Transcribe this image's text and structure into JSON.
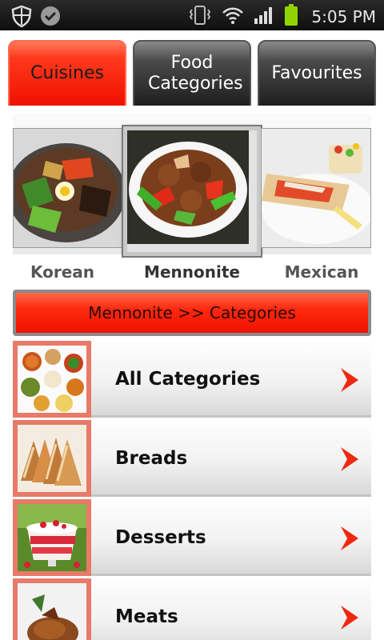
{
  "status_bar": {
    "time": "5:05 PM",
    "icons": [
      "shield-icon",
      "check-icon",
      "vibrate-icon",
      "wifi-icon",
      "signal-icon",
      "battery-icon"
    ]
  },
  "tabs": [
    {
      "label": "Cuisines",
      "active": true
    },
    {
      "label": "Food Categories",
      "active": false
    },
    {
      "label": "Favourites",
      "active": false
    }
  ],
  "carousel": {
    "items": [
      {
        "label": "Korean",
        "image": "bibimbap-photo"
      },
      {
        "label": "Mennonite",
        "image": "stir-fry-photo",
        "selected": true
      },
      {
        "label": "Mexican",
        "image": "burrito-photo"
      }
    ]
  },
  "breadcrumb": {
    "text": "Mennonite >> Categories"
  },
  "categories": [
    {
      "label": "All Categories",
      "image": "assorted-dishes-photo"
    },
    {
      "label": "Breads",
      "image": "bread-loaf-photo"
    },
    {
      "label": "Desserts",
      "image": "trifle-photo"
    },
    {
      "label": "Meats",
      "image": "roast-meat-photo"
    }
  ],
  "colors": {
    "accent": "#ff2a10",
    "tab_inactive": "#2a2a2a",
    "thumb_border": "#e87a6a"
  }
}
